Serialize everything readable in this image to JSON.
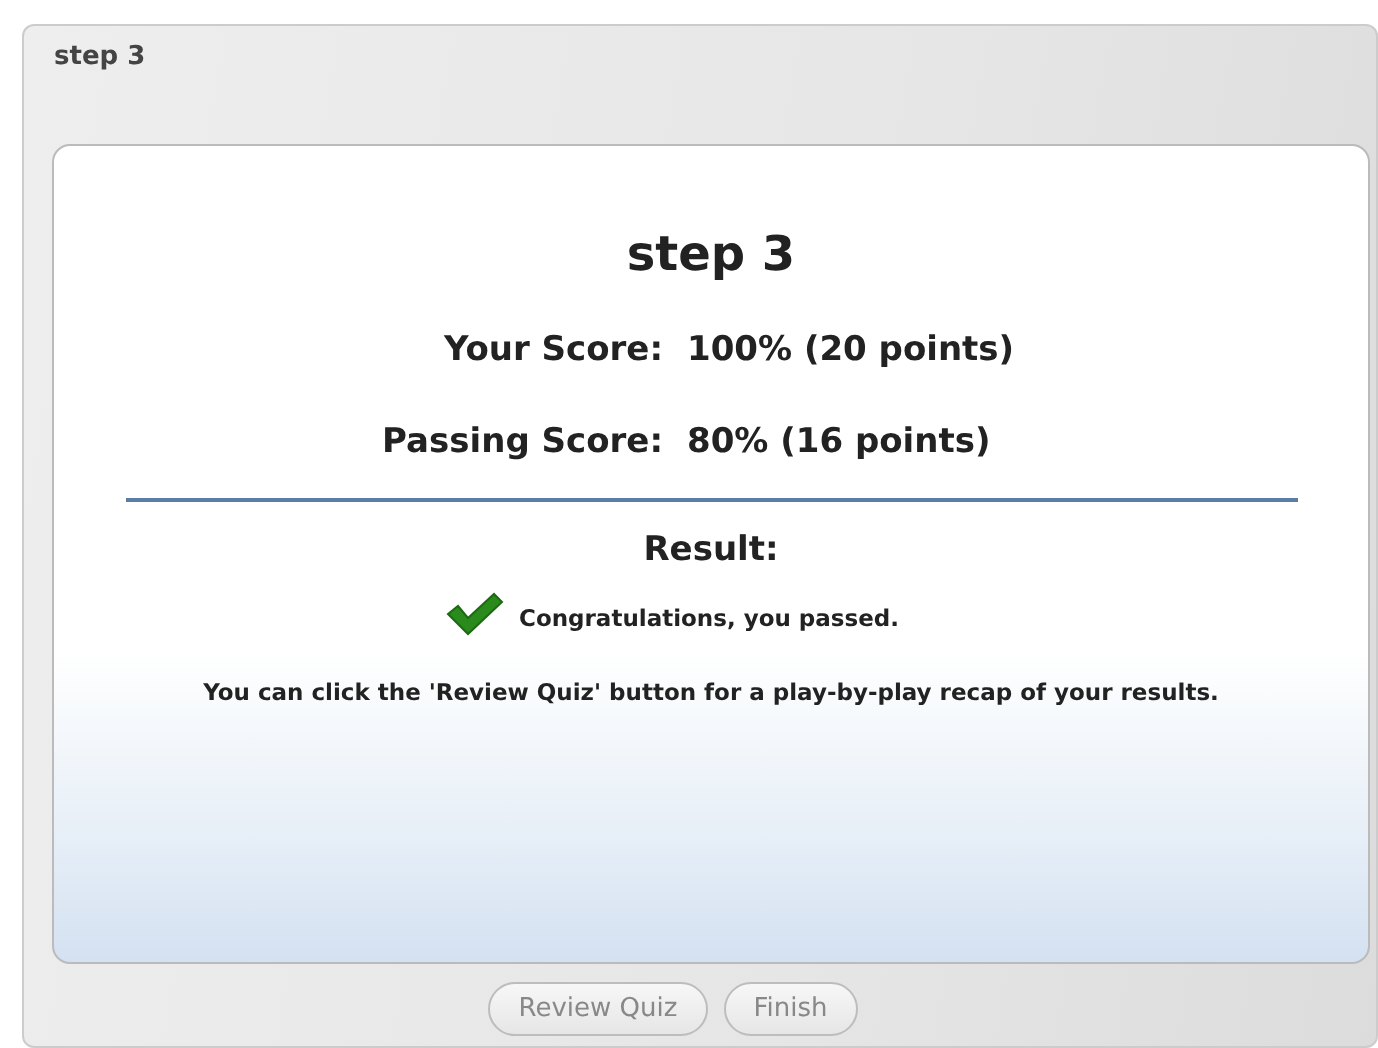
{
  "window": {
    "title": "step 3"
  },
  "result": {
    "heading": "step 3",
    "scores": [
      {
        "label": "Your Score:",
        "value": "100% (20 points)"
      },
      {
        "label": "Passing Score:",
        "value": "80% (16 points)"
      }
    ],
    "result_label": "Result:",
    "passed": true,
    "message": "Congratulations, you passed.",
    "note": "You can click the 'Review Quiz' button for a play-by-play recap of your results."
  },
  "buttons": [
    {
      "label": "Review Quiz"
    },
    {
      "label": "Finish"
    }
  ]
}
